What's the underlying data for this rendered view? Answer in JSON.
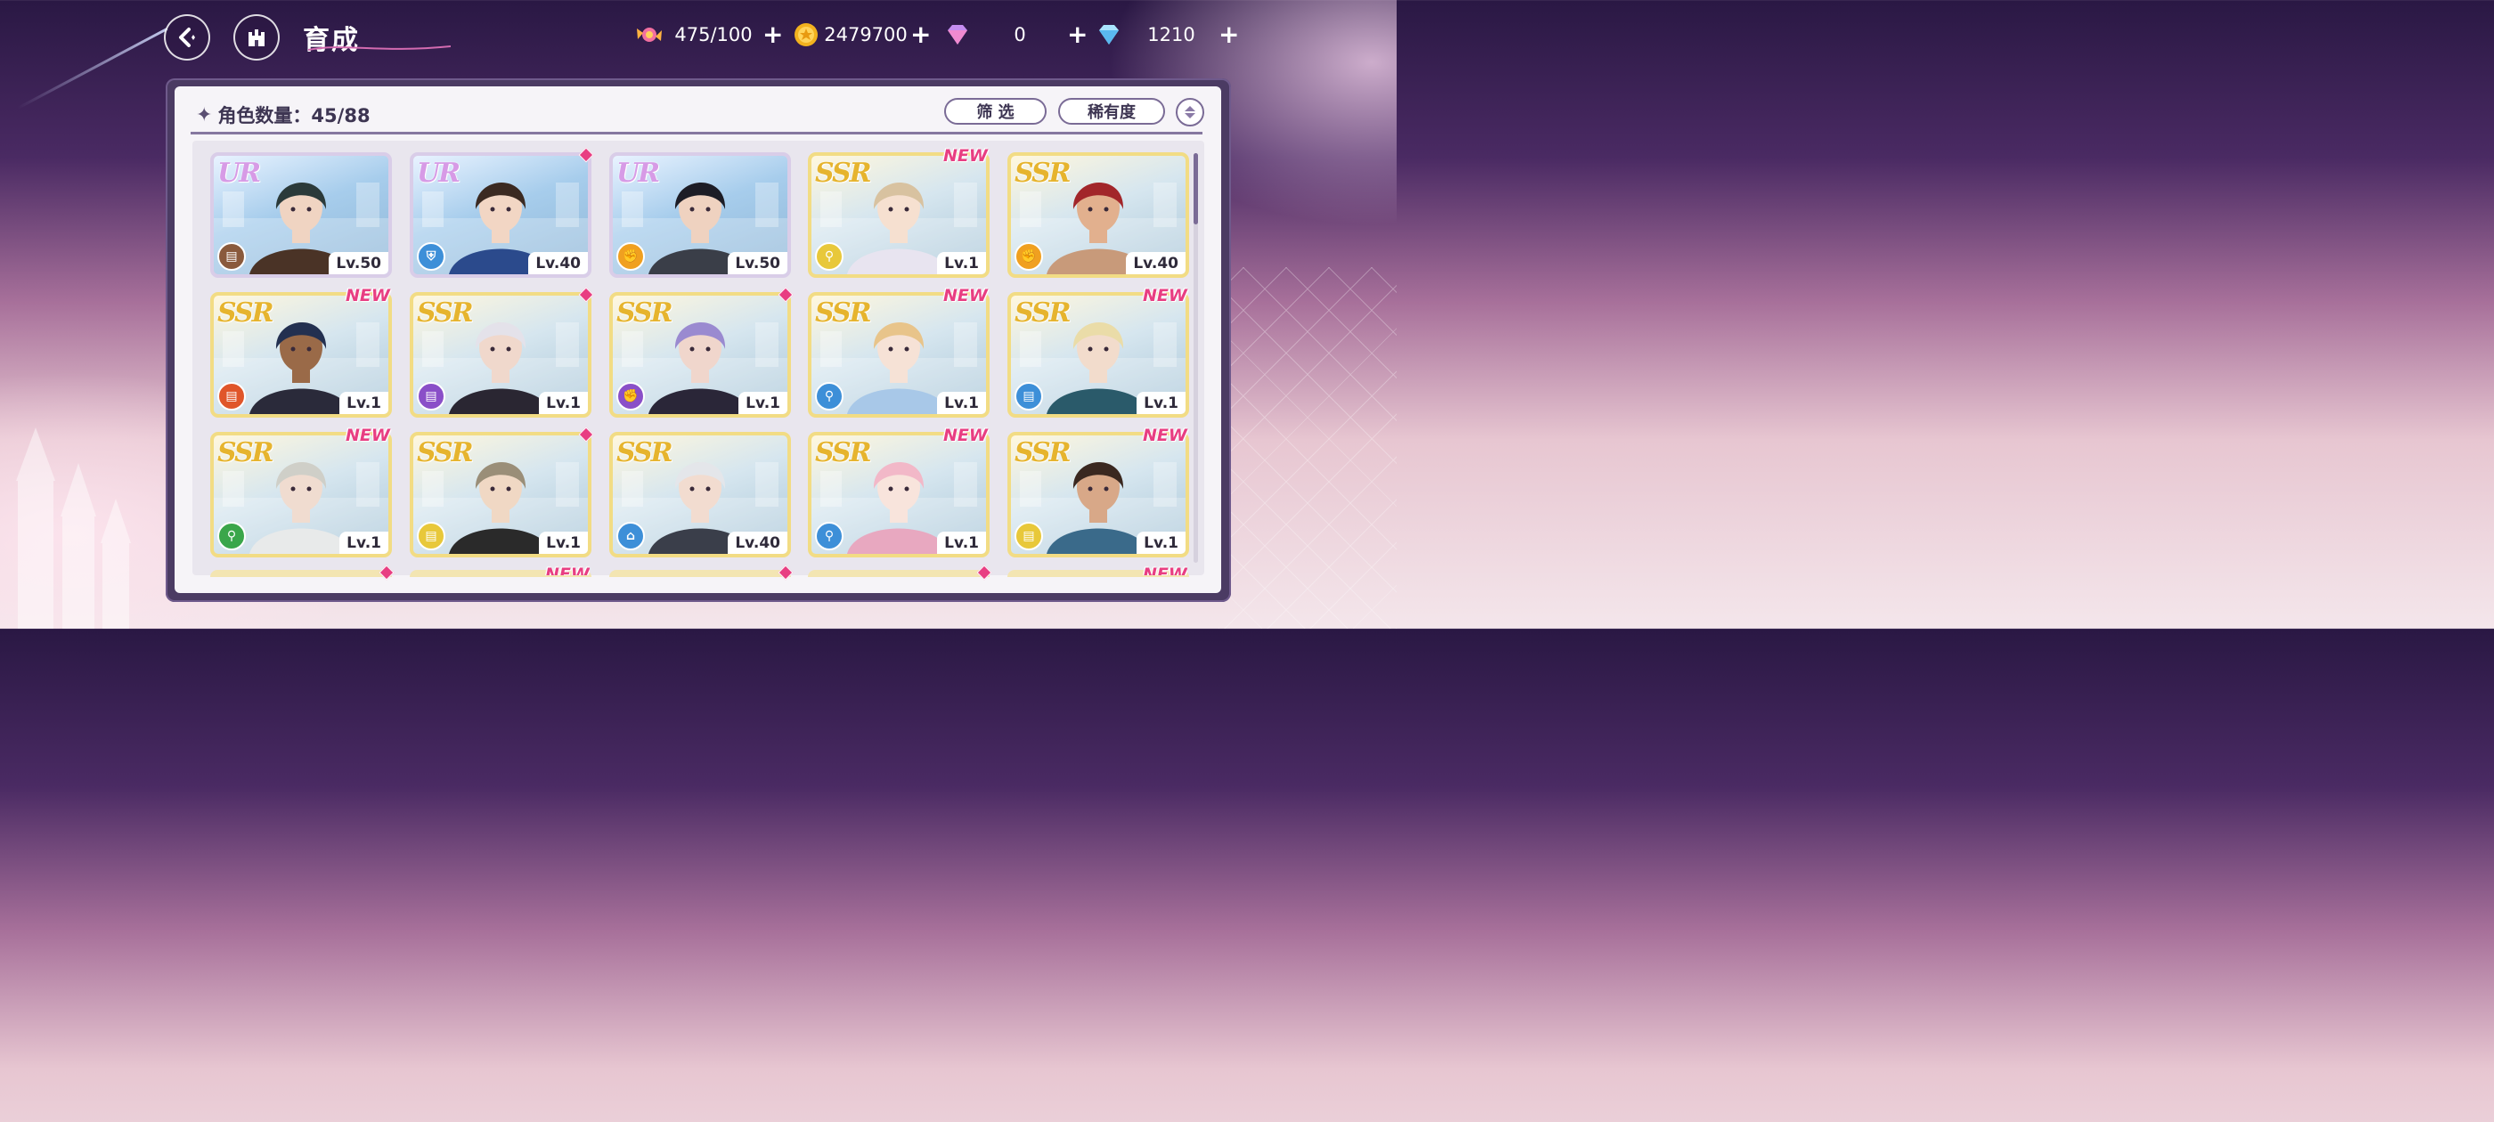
{
  "header": {
    "title": "育成",
    "resources": [
      {
        "name": "stamina",
        "icon": "candy-icon",
        "value": "475/100"
      },
      {
        "name": "gold",
        "icon": "coin-icon",
        "value": "2479700"
      },
      {
        "name": "paid-gem",
        "icon": "pink-gem-icon",
        "value": "0"
      },
      {
        "name": "free-gem",
        "icon": "blue-diamond-icon",
        "value": "1210"
      }
    ]
  },
  "panel": {
    "count_label": "角色数量：45/88",
    "filter_label": "筛 选",
    "sort_label": "稀有度"
  },
  "colors": {
    "accent": "#e83e82",
    "panel_border": "#4b3b63",
    "ur_frame": "#d9cde8",
    "ssr_frame": "#f2dc84"
  },
  "cards": [
    {
      "rarity": "UR",
      "level": "Lv.50",
      "class_icon": "book-icon",
      "class_color": "#8a5a3c",
      "badge": "",
      "hair": "#2b3a3a",
      "skin": "#f0d4c2",
      "coat": "#4a3326"
    },
    {
      "rarity": "UR",
      "level": "Lv.40",
      "class_icon": "shield-icon",
      "class_color": "#3d8fd8",
      "badge": "dot",
      "hair": "#3b2a22",
      "skin": "#f2d6c4",
      "coat": "#2b4a8c"
    },
    {
      "rarity": "UR",
      "level": "Lv.50",
      "class_icon": "fist-icon",
      "class_color": "#f0a020",
      "badge": "",
      "hair": "#1d1d26",
      "skin": "#efd2c0",
      "coat": "#3a3e48"
    },
    {
      "rarity": "SSR",
      "level": "Lv.1",
      "class_icon": "wand-icon",
      "class_color": "#e8c83a",
      "badge": "NEW",
      "hair": "#d8c2a0",
      "skin": "#f6e0d0",
      "coat": "#e8e4f0"
    },
    {
      "rarity": "SSR",
      "level": "Lv.40",
      "class_icon": "fist-icon",
      "class_color": "#f0a020",
      "badge": "",
      "hair": "#a2262a",
      "skin": "#e2b08e",
      "coat": "#c89a7a"
    },
    {
      "rarity": "SSR",
      "level": "Lv.1",
      "class_icon": "book-icon",
      "class_color": "#e0562a",
      "badge": "NEW",
      "hair": "#233050",
      "skin": "#9a6a48",
      "coat": "#2a2a3a"
    },
    {
      "rarity": "SSR",
      "level": "Lv.1",
      "class_icon": "book-icon",
      "class_color": "#8a4fc8",
      "badge": "dot",
      "hair": "#e4e2ea",
      "skin": "#f0d8cc",
      "coat": "#2a2632"
    },
    {
      "rarity": "SSR",
      "level": "Lv.1",
      "class_icon": "fist-icon",
      "class_color": "#8a4fc8",
      "badge": "dot",
      "hair": "#9a8ad0",
      "skin": "#f0d6cc",
      "coat": "#2a2638"
    },
    {
      "rarity": "SSR",
      "level": "Lv.1",
      "class_icon": "wand-icon",
      "class_color": "#3d8fd8",
      "badge": "NEW",
      "hair": "#e8c48a",
      "skin": "#f6e2d6",
      "coat": "#a8c8e8"
    },
    {
      "rarity": "SSR",
      "level": "Lv.1",
      "class_icon": "book-icon",
      "class_color": "#3d8fd8",
      "badge": "NEW",
      "hair": "#eadca8",
      "skin": "#f2dccc",
      "coat": "#2a5a6a"
    },
    {
      "rarity": "SSR",
      "level": "Lv.1",
      "class_icon": "wand-icon",
      "class_color": "#3aa64a",
      "badge": "NEW",
      "hair": "#cfcfc8",
      "skin": "#f0dcd0",
      "coat": "#e8eaea"
    },
    {
      "rarity": "SSR",
      "level": "Lv.1",
      "class_icon": "book-icon",
      "class_color": "#e8c83a",
      "badge": "dot",
      "hair": "#9a8e78",
      "skin": "#f0d8c4",
      "coat": "#2a2a2a"
    },
    {
      "rarity": "SSR",
      "level": "Lv.40",
      "class_icon": "boot-icon",
      "class_color": "#3d8fd8",
      "badge": "",
      "hair": "#e4e6ea",
      "skin": "#f2dcd0",
      "coat": "#3a3e4a"
    },
    {
      "rarity": "SSR",
      "level": "Lv.1",
      "class_icon": "wand-icon",
      "class_color": "#3d8fd8",
      "badge": "NEW",
      "hair": "#f2b8c8",
      "skin": "#f8e4dc",
      "coat": "#e8a8c0"
    },
    {
      "rarity": "SSR",
      "level": "Lv.1",
      "class_icon": "book-icon",
      "class_color": "#e8c83a",
      "badge": "NEW",
      "hair": "#3a2820",
      "skin": "#d8a888",
      "coat": "#3a6a8a"
    }
  ],
  "partial_row_badges": [
    "dot",
    "NEW",
    "dot",
    "dot",
    "NEW"
  ]
}
